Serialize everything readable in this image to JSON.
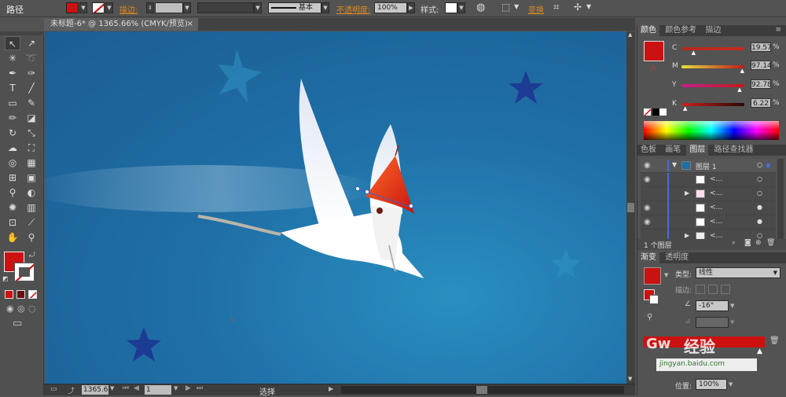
{
  "control_bar": {
    "mode_label": "路径",
    "fill_color": "#cc1111",
    "stroke_label": "描边:",
    "stroke_profile_label": "基本",
    "opacity_label": "不透明度:",
    "opacity_value": "100%",
    "style_label": "样式:",
    "transform_label": "变换"
  },
  "document_tab": {
    "title": "未标题-6* @ 1365.66% (CMYK/预览)",
    "close_glyph": "×"
  },
  "status_bar": {
    "zoom_value": "1365.6",
    "page_value": "1",
    "tool_label": "选择"
  },
  "color_panel": {
    "tabs": [
      "颜色",
      "颜色参考",
      "描边"
    ],
    "fill_color": "#cc1111",
    "channels": [
      {
        "name": "C",
        "value": "19.57",
        "fraction": 0.196
      },
      {
        "name": "M",
        "value": "97.14",
        "fraction": 0.971
      },
      {
        "name": "Y",
        "value": "92.78",
        "fraction": 0.928
      },
      {
        "name": "K",
        "value": "6.22",
        "fraction": 0.062
      }
    ]
  },
  "layers_panel": {
    "tabs": [
      "色板",
      "画笔",
      "图层",
      "路径查找器"
    ],
    "active_tab": "图层",
    "layer_name": "图层 1",
    "sublayer_names": [
      "<...",
      "<...",
      "<...",
      "<...",
      "<..."
    ],
    "footer_label": "1 个图层"
  },
  "gradient_panel": {
    "tabs": [
      "渐变",
      "透明度"
    ],
    "type_label": "类型:",
    "type_value": "线性",
    "stroke_label": "描边:",
    "angle_value": "-16°",
    "position_label": "位置:",
    "position_value": "100%"
  },
  "watermark": {
    "text": "经验",
    "sub_text": "jingyan.baidu.com"
  }
}
